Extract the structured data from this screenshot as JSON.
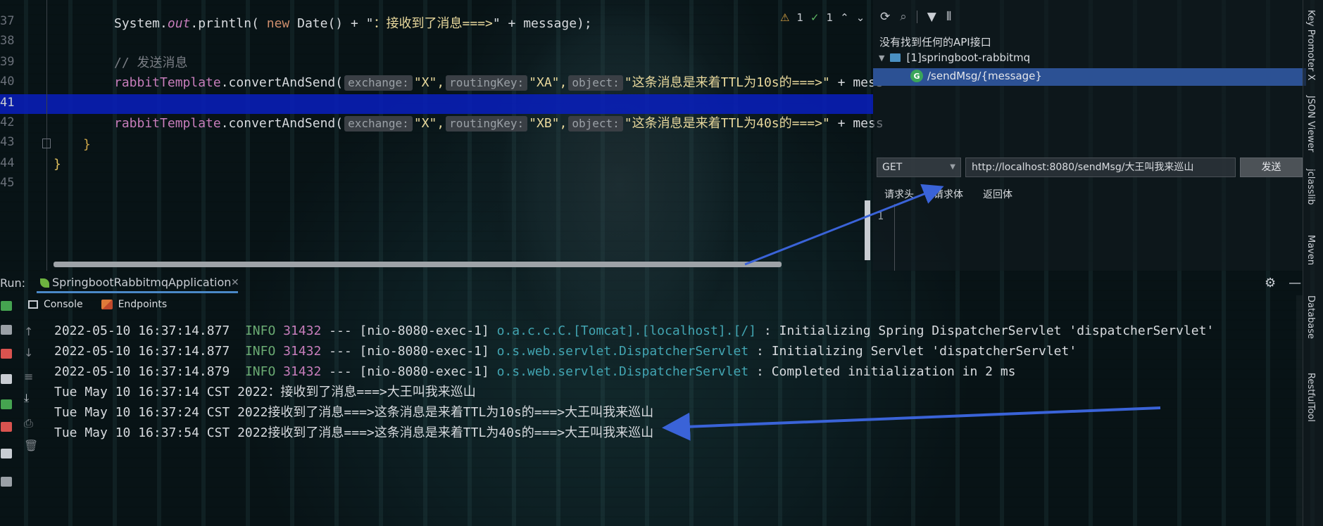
{
  "editor": {
    "line_numbers": [
      "37",
      "38",
      "39",
      "40",
      "41",
      "42",
      "43",
      "44",
      "45"
    ],
    "lines": {
      "l37": {
        "obj": "System.",
        "field": "out",
        "call": ".println( ",
        "kw": "new",
        "rest1": " Date() + \"",
        "str": "：接收到了消息===>",
        "rest2": "\" + message);"
      },
      "l39": {
        "comment": "// 发送消息"
      },
      "l40": {
        "tmpl": "rabbitTemplate",
        "call": ".convertAndSend(",
        "h1": "exchange:",
        "v1": "\"X\",",
        "h2": "routingKey:",
        "v2": "\"XA\",",
        "h3": "object:",
        "v3": "\"这条消息是来着TTL为10s的===>\"",
        "rest": " + mess"
      },
      "l42": {
        "tmpl": "rabbitTemplate",
        "call": ".convertAndSend(",
        "h1": "exchange:",
        "v1": "\"X\",",
        "h2": "routingKey:",
        "v2": "\"XB\",",
        "h3": "object:",
        "v3": "\"这条消息是来着TTL为40s的===>\"",
        "rest": " + mess"
      },
      "l43": {
        "brace": "}"
      },
      "l44": {
        "brace": "}"
      }
    },
    "inspections": {
      "warnings": "1",
      "ok": "1"
    }
  },
  "restful": {
    "message": "没有找到任何的API接口",
    "module": "[1]springboot-rabbitmq",
    "endpoint": "/sendMsg/{message}",
    "method": "GET",
    "url": "http://localhost:8080/sendMsg/大王叫我来巡山",
    "send_label": "发送",
    "tabs": [
      "请求头",
      "请求体",
      "返回体"
    ],
    "body_line": "1"
  },
  "right_toolbar": [
    "Key Promoter X",
    "JSON Viewer",
    "jclasslib",
    "Maven",
    "Database",
    "RestfulTool"
  ],
  "run": {
    "label": "Run:",
    "config": "SpringbootRabbitmqApplication",
    "subtabs": [
      "Console",
      "Endpoints"
    ]
  },
  "console": [
    {
      "ts": "2022-05-10 16:37:14.877",
      "level": "INFO",
      "pid": "31432",
      "thread": " --- [nio-8080-exec-1] ",
      "logger": "o.a.c.c.C.[Tomcat].[localhost].[/]      ",
      "msg": " : Initializing Spring DispatcherServlet 'dispatcherServlet'"
    },
    {
      "ts": "2022-05-10 16:37:14.877",
      "level": "INFO",
      "pid": "31432",
      "thread": " --- [nio-8080-exec-1] ",
      "logger": "o.s.web.servlet.DispatcherServlet       ",
      "msg": " : Initializing Servlet 'dispatcherServlet'"
    },
    {
      "ts": "2022-05-10 16:37:14.879",
      "level": "INFO",
      "pid": "31432",
      "thread": " --- [nio-8080-exec-1] ",
      "logger": "o.s.web.servlet.DispatcherServlet       ",
      "msg": " : Completed initialization in 2 ms"
    },
    {
      "plain": "Tue May 10 16:37:14 CST 2022：接收到了消息===>大王叫我来巡山"
    },
    {
      "plain": "Tue May 10 16:37:24 CST 2022接收到了消息===>这条消息是来着TTL为10s的===>大王叫我来巡山"
    },
    {
      "plain": "Tue May 10 16:37:54 CST 2022接收到了消息===>这条消息是来着TTL为40s的===>大王叫我来巡山"
    }
  ],
  "colors": {
    "selection": "#2c5194",
    "highlight_row": "#0c1fc0",
    "arrow": "#3a63d8"
  }
}
